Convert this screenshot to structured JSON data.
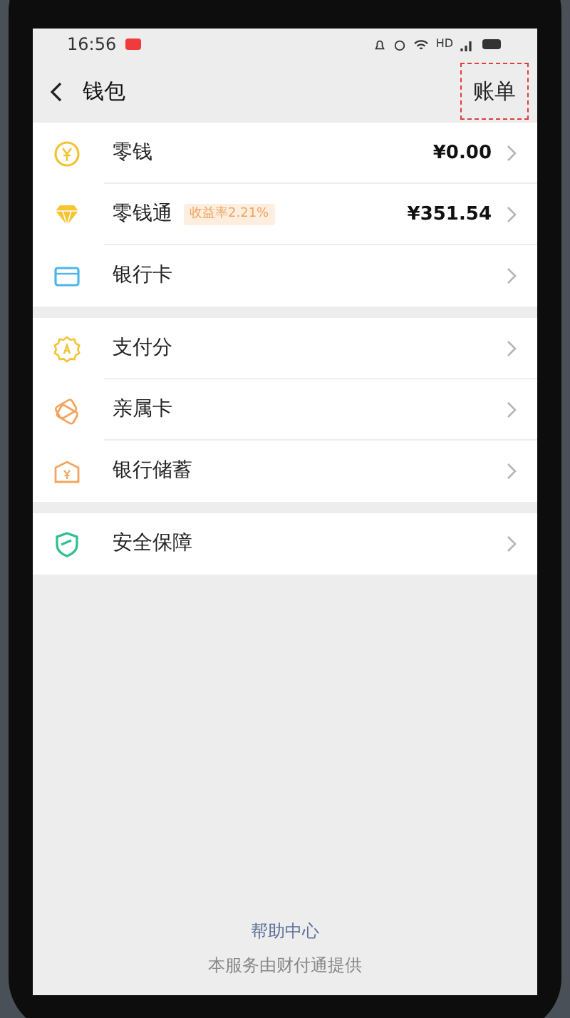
{
  "status_bar": {
    "time": "16:56",
    "network": "HD"
  },
  "header": {
    "title": "钱包",
    "action": {
      "label": "账单",
      "highlighted": true
    }
  },
  "groups": [
    {
      "items": [
        {
          "kind": "coin",
          "label": "零钱",
          "value": "¥0.00"
        },
        {
          "kind": "diamond",
          "label": "零钱通",
          "badge": "收益率2.21%",
          "value": "¥351.54"
        },
        {
          "kind": "card",
          "label": "银行卡"
        }
      ]
    },
    {
      "items": [
        {
          "kind": "score",
          "label": "支付分"
        },
        {
          "kind": "family",
          "label": "亲属卡"
        },
        {
          "kind": "savings",
          "label": "银行储蓄"
        }
      ]
    },
    {
      "items": [
        {
          "kind": "shield",
          "label": "安全保障"
        }
      ]
    }
  ],
  "footer": {
    "link": "帮助中心",
    "note": "本服务由财付通提供"
  }
}
